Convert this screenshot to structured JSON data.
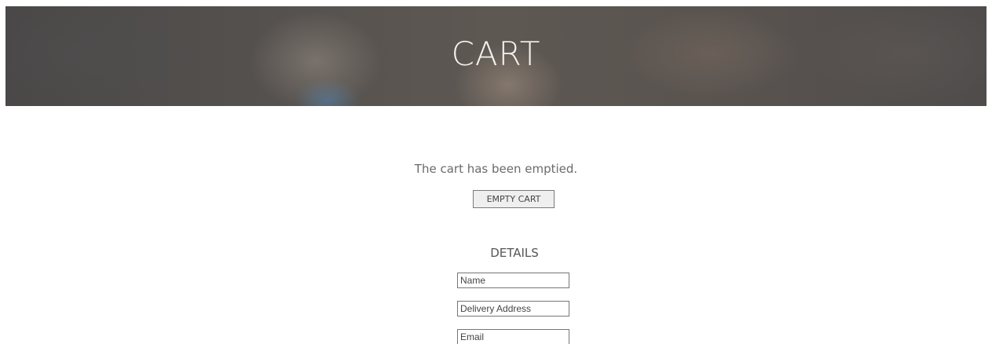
{
  "hero": {
    "title": "CART"
  },
  "cart": {
    "message": "The cart has been emptied.",
    "empty_button_label": "EMPTY CART"
  },
  "details": {
    "heading": "DETAILS",
    "fields": [
      {
        "placeholder": "Name",
        "value": ""
      },
      {
        "placeholder": "Delivery Address",
        "value": ""
      },
      {
        "placeholder": "Email",
        "value": ""
      }
    ]
  }
}
